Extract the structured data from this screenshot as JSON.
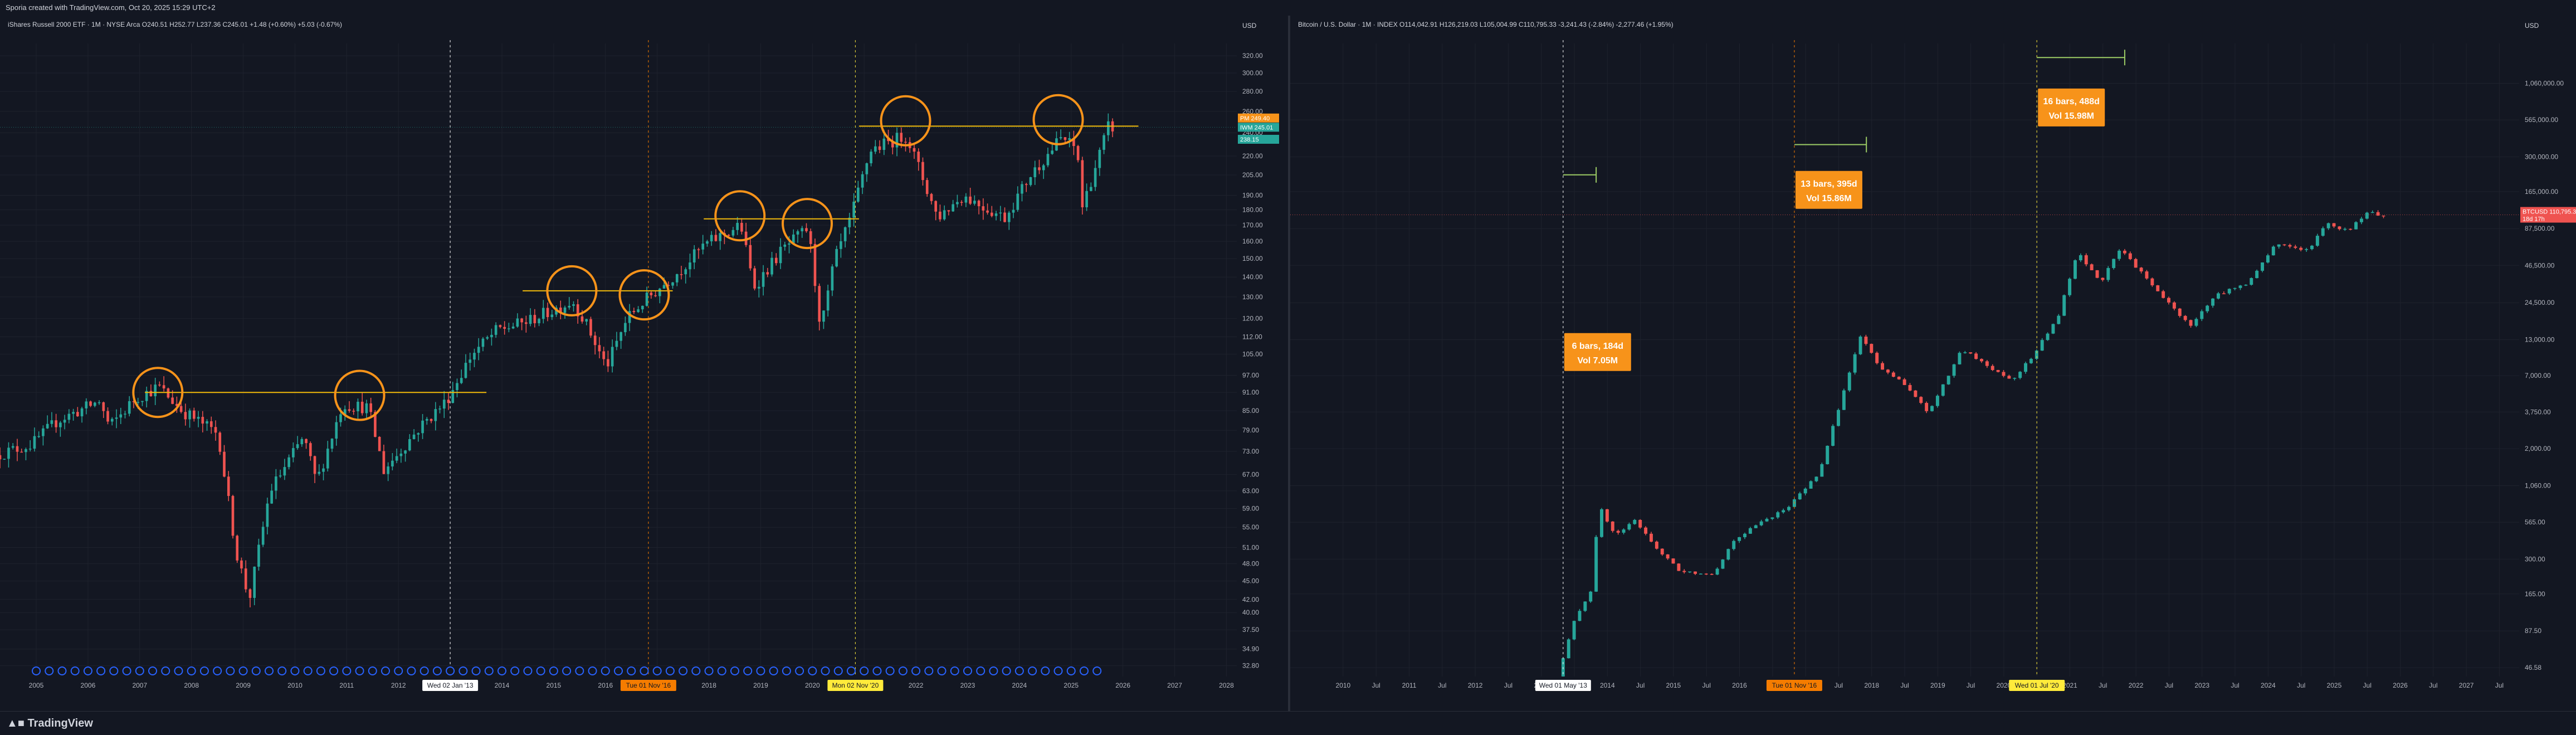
{
  "header": {
    "title": "Sporia created with TradingView.com, Oct 20, 2025 15:29 UTC+2"
  },
  "footer": {
    "brand": "TradingView"
  },
  "colors": {
    "up": "#26a69a",
    "down": "#ef5350",
    "bg": "#131722",
    "grid": "#1e222d",
    "annotation": "#f7931a",
    "marker": "#ffd54f"
  },
  "chart_data": [
    {
      "type": "candlestick",
      "scale": "log",
      "legend_text": "iShares Russell 2000 ETF · 1M · NYSE Arca  O240.51 H252.77 L237.36 C245.01 +1.48 (+0.60%)  +5.03 (-0.67%)",
      "currency": "USD",
      "x_ticks": [
        "2005",
        "2006",
        "2007",
        "2008",
        "2009",
        "2010",
        "2011",
        "2012",
        "2013",
        "2014",
        "2015",
        "2016",
        "2017",
        "2018",
        "2019",
        "2020",
        "2021",
        "2022",
        "2023",
        "2024",
        "2025",
        "2026",
        "2027",
        "2028"
      ],
      "x_range": [
        2004.3,
        2028.2
      ],
      "y_ticks": [
        32.8,
        34.9,
        37.5,
        40,
        42,
        45,
        48,
        51,
        55,
        59,
        63,
        67,
        73,
        79,
        85,
        91,
        97,
        105,
        112,
        120,
        130,
        140,
        150,
        160,
        170,
        180,
        190,
        205,
        220,
        240,
        260,
        280,
        300,
        320
      ],
      "y_range": [
        31.5,
        335
      ],
      "price_labels": [
        {
          "label": "PM",
          "value": "249.40"
        },
        {
          "label": "IWM",
          "value": "245.01"
        },
        {
          "label": "",
          "value": "238.15"
        }
      ],
      "date_markers": [
        "Wed 02 Jan '13",
        "Tue 01 Nov '16",
        "Mon 02 Nov '20"
      ],
      "keypoints": [
        [
          2004.3,
          72
        ],
        [
          2005.0,
          75
        ],
        [
          2005.5,
          82
        ],
        [
          2006.3,
          88
        ],
        [
          2006.5,
          80
        ],
        [
          2007.0,
          89
        ],
        [
          2007.45,
          93
        ],
        [
          2007.9,
          85
        ],
        [
          2008.6,
          78
        ],
        [
          2008.95,
          50
        ],
        [
          2009.2,
          42
        ],
        [
          2009.6,
          63
        ],
        [
          2010.25,
          77
        ],
        [
          2010.5,
          65
        ],
        [
          2011.0,
          87
        ],
        [
          2011.5,
          86
        ],
        [
          2011.8,
          68
        ],
        [
          2012.5,
          80
        ],
        [
          2013.0,
          88
        ],
        [
          2013.5,
          105
        ],
        [
          2014.0,
          115
        ],
        [
          2014.5,
          118
        ],
        [
          2015.0,
          123
        ],
        [
          2015.45,
          128
        ],
        [
          2015.7,
          118
        ],
        [
          2016.1,
          100
        ],
        [
          2016.5,
          120
        ],
        [
          2016.83,
          128
        ],
        [
          2017.5,
          143
        ],
        [
          2018.0,
          158
        ],
        [
          2018.7,
          170
        ],
        [
          2018.95,
          135
        ],
        [
          2019.5,
          155
        ],
        [
          2020.0,
          168
        ],
        [
          2020.25,
          115
        ],
        [
          2020.5,
          148
        ],
        [
          2020.83,
          175
        ],
        [
          2021.2,
          225
        ],
        [
          2021.9,
          238
        ],
        [
          2022.5,
          175
        ],
        [
          2023.0,
          190
        ],
        [
          2023.5,
          180
        ],
        [
          2023.8,
          175
        ],
        [
          2024.3,
          205
        ],
        [
          2024.9,
          236
        ],
        [
          2025.2,
          225
        ],
        [
          2025.3,
          182
        ],
        [
          2025.8,
          245
        ]
      ],
      "series_levels": [
        {
          "name": "",
          "x_start": 2007.1,
          "x_end": 2013.7,
          "value": 91
        },
        {
          "name": "",
          "x_start": 2014.4,
          "x_end": 2017.3,
          "value": 133
        },
        {
          "name": "",
          "x_start": 2017.9,
          "x_end": 2020.9,
          "value": 174
        },
        {
          "name": "",
          "x_start": 2020.9,
          "x_end": 2026.3,
          "value": 246
        }
      ],
      "circles": [
        {
          "x": 2007.35,
          "y": 91
        },
        {
          "x": 2011.25,
          "y": 90
        },
        {
          "x": 2015.35,
          "y": 133
        },
        {
          "x": 2016.75,
          "y": 131
        },
        {
          "x": 2018.6,
          "y": 176
        },
        {
          "x": 2019.9,
          "y": 171
        },
        {
          "x": 2021.8,
          "y": 251
        },
        {
          "x": 2024.75,
          "y": 252
        }
      ]
    },
    {
      "type": "candlestick",
      "scale": "log",
      "legend_text": "Bitcoin / U.S. Dollar · 1M · INDEX  O114,042.91 H126,219.03 L105,004.99 C110,795.33 -3,241.43 (-2.84%)  -2,277.46 (+1.95%)",
      "currency": "USD",
      "x_ticks": [
        "2010",
        "Jul",
        "2011",
        "Jul",
        "2012",
        "Jul",
        "2013",
        "Jul",
        "2014",
        "Jul",
        "2015",
        "Jul",
        "2016",
        "Jul",
        "2017",
        "Jul",
        "2018",
        "Jul",
        "2019",
        "Jul",
        "2020",
        "Jul",
        "2021",
        "Jul",
        "2022",
        "Jul",
        "2023",
        "Jul",
        "2024",
        "Jul",
        "2025",
        "Jul",
        "2026",
        "Jul",
        "2027",
        "Jul"
      ],
      "x_range": [
        2009.2,
        2027.8
      ],
      "y_ticks": [
        46.58,
        87.5,
        165,
        300,
        565,
        1060,
        2000,
        3750,
        7000,
        13000,
        24500,
        46500,
        87500,
        165000,
        300000,
        565000,
        1060000
      ],
      "y_range": [
        40,
        2100000
      ],
      "price_labels": [
        {
          "label": "BTCUSD",
          "value": "110,795.33"
        },
        {
          "label": "",
          "value": "18d 17h"
        }
      ],
      "date_markers": [
        "Wed 01 May '13",
        "Tue 01 Nov '16",
        "Wed 01 Jul '20"
      ],
      "keypoints": [
        [
          2013.33,
          40
        ],
        [
          2013.6,
          110
        ],
        [
          2013.85,
          180
        ],
        [
          2013.95,
          760
        ],
        [
          2014.2,
          450
        ],
        [
          2014.5,
          580
        ],
        [
          2014.9,
          330
        ],
        [
          2015.2,
          240
        ],
        [
          2015.7,
          235
        ],
        [
          2016.0,
          420
        ],
        [
          2016.4,
          560
        ],
        [
          2016.83,
          740
        ],
        [
          2017.3,
          1350
        ],
        [
          2017.6,
          4300
        ],
        [
          2017.92,
          14000
        ],
        [
          2018.2,
          8000
        ],
        [
          2018.5,
          6600
        ],
        [
          2018.95,
          3700
        ],
        [
          2019.45,
          11000
        ],
        [
          2019.8,
          8500
        ],
        [
          2020.2,
          6500
        ],
        [
          2020.5,
          9500
        ],
        [
          2020.9,
          19000
        ],
        [
          2021.2,
          58000
        ],
        [
          2021.55,
          35000
        ],
        [
          2021.85,
          62000
        ],
        [
          2022.4,
          30000
        ],
        [
          2022.9,
          16500
        ],
        [
          2023.3,
          28000
        ],
        [
          2023.8,
          35000
        ],
        [
          2024.2,
          68000
        ],
        [
          2024.7,
          60000
        ],
        [
          2024.95,
          95000
        ],
        [
          2025.3,
          85000
        ],
        [
          2025.6,
          115000
        ],
        [
          2025.8,
          110795
        ]
      ],
      "measures": [
        {
          "x_start": 2013.33,
          "x_end": 2013.83,
          "anchor": 220000,
          "label1": "6 bars, 184d",
          "label2": "Vol 7.05M",
          "box_y": 10500
        },
        {
          "x_start": 2016.83,
          "x_end": 2017.92,
          "anchor": 370000,
          "label1": "13 bars, 395d",
          "label2": "Vol 15.86M",
          "box_y": 170000
        },
        {
          "x_start": 2020.5,
          "x_end": 2021.83,
          "anchor": 1650000,
          "label1": "16 bars, 488d",
          "label2": "Vol 15.98M",
          "box_y": 700000
        }
      ]
    }
  ]
}
